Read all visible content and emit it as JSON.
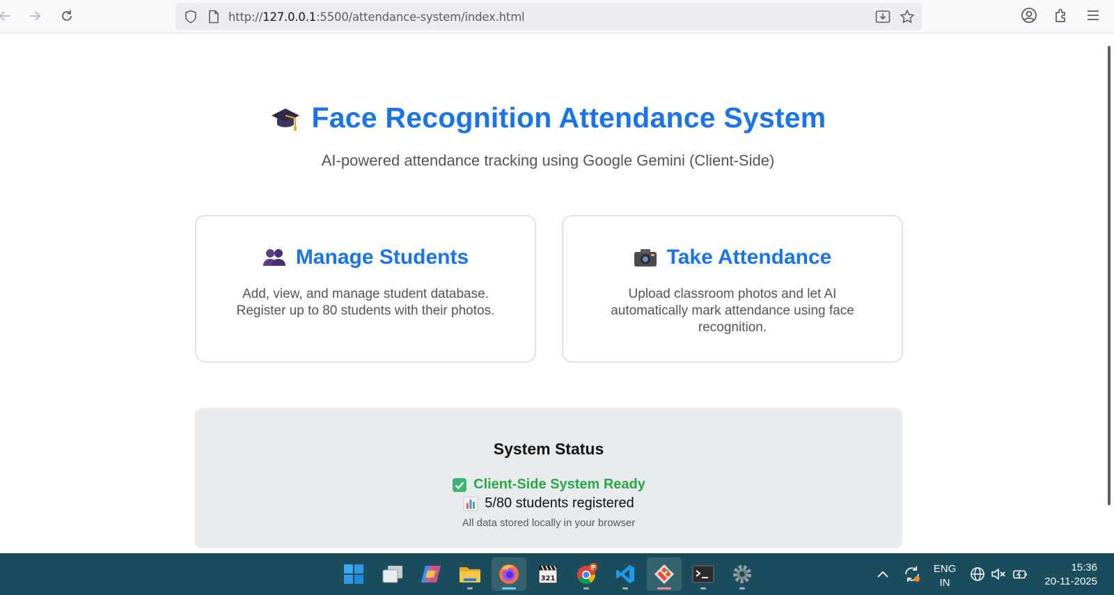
{
  "browser": {
    "url_prefix": "http://",
    "url_host": "127.0.0.1",
    "url_rest": ":5500/attendance-system/index.html"
  },
  "page": {
    "title": "Face Recognition Attendance System",
    "subtitle": "AI-powered attendance tracking using Google Gemini (Client-Side)",
    "cards": [
      {
        "title": "Manage Students",
        "icon": "people-icon",
        "description": "Add, view, and manage student database. Register up to 80 students with their photos."
      },
      {
        "title": "Take Attendance",
        "icon": "camera-icon",
        "description": "Upload classroom photos and let AI automatically mark attendance using face recognition."
      }
    ],
    "status": {
      "heading": "System Status",
      "ready": "Client-Side System Ready",
      "count": "5/80 students registered",
      "note": "All data stored locally in your browser"
    }
  },
  "taskbar": {
    "language_line1": "ENG",
    "language_line2": "IN",
    "time": "15:36",
    "date": "20-11-2025",
    "chrome_badge": "P"
  },
  "colors": {
    "accent": "#1a73e8",
    "ready": "#28a745",
    "taskbar": "#1b4d5c"
  }
}
